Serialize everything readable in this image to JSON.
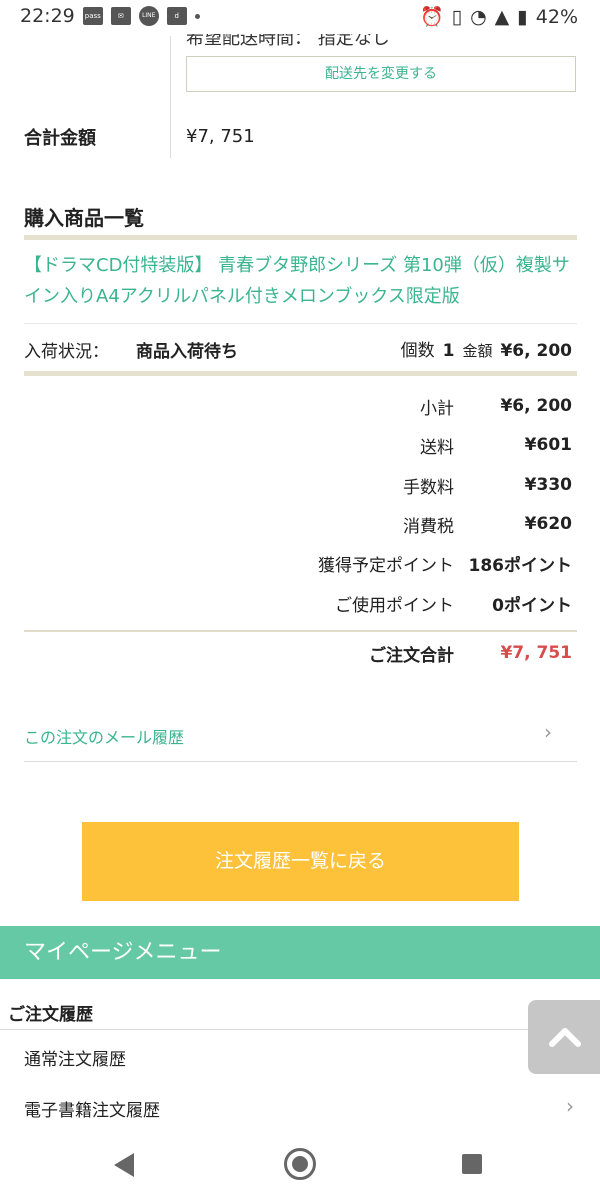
{
  "status_bar": {
    "time": "22:29",
    "icons_left": [
      "pass",
      "mail-icon",
      "LINE",
      "d",
      "dot"
    ],
    "battery": "42%"
  },
  "address": {
    "delivery_time_text": "希望配送時間： 指定なし",
    "change_button": "配送先を変更する"
  },
  "total": {
    "label": "合計金額",
    "value": "¥7, 751"
  },
  "purchase_list": {
    "title": "購入商品一覧",
    "product_name": "【ドラマCD付特装版】 青春ブタ野郎シリーズ 第10弾（仮）複製サイン入りA4アクリルパネル付きメロンブックス限定版",
    "status_label": "入荷状況：",
    "status_value": "商品入荷待ち",
    "qty_label": "個数",
    "qty_value": "1",
    "amount_label": "金額",
    "amount_value": "¥6, 200"
  },
  "summary": {
    "rows": [
      {
        "label": "小計",
        "value": "¥6, 200"
      },
      {
        "label": "送料",
        "value": "¥601"
      },
      {
        "label": "手数料",
        "value": "¥330"
      },
      {
        "label": "消費税",
        "value": "¥620"
      },
      {
        "label": "獲得予定ポイント",
        "value": "186ポイント"
      },
      {
        "label": "ご使用ポイント",
        "value": "0ポイント"
      }
    ],
    "grand_label": "ご注文合計",
    "grand_value": "¥7, 751"
  },
  "mail_history": {
    "label": "この注文のメール履歴",
    "chevron": "›"
  },
  "back_button": "注文履歴一覧に戻る",
  "mypage_menu": {
    "title": "マイページメニュー",
    "section": "ご注文履歴",
    "items": [
      "通常注文履歴",
      "電子書籍注文履歴"
    ]
  },
  "colors": {
    "accent": "#3ab58e",
    "menu_bar": "#66c9a6",
    "button": "#fec23a",
    "price_red": "#d84c4c"
  }
}
